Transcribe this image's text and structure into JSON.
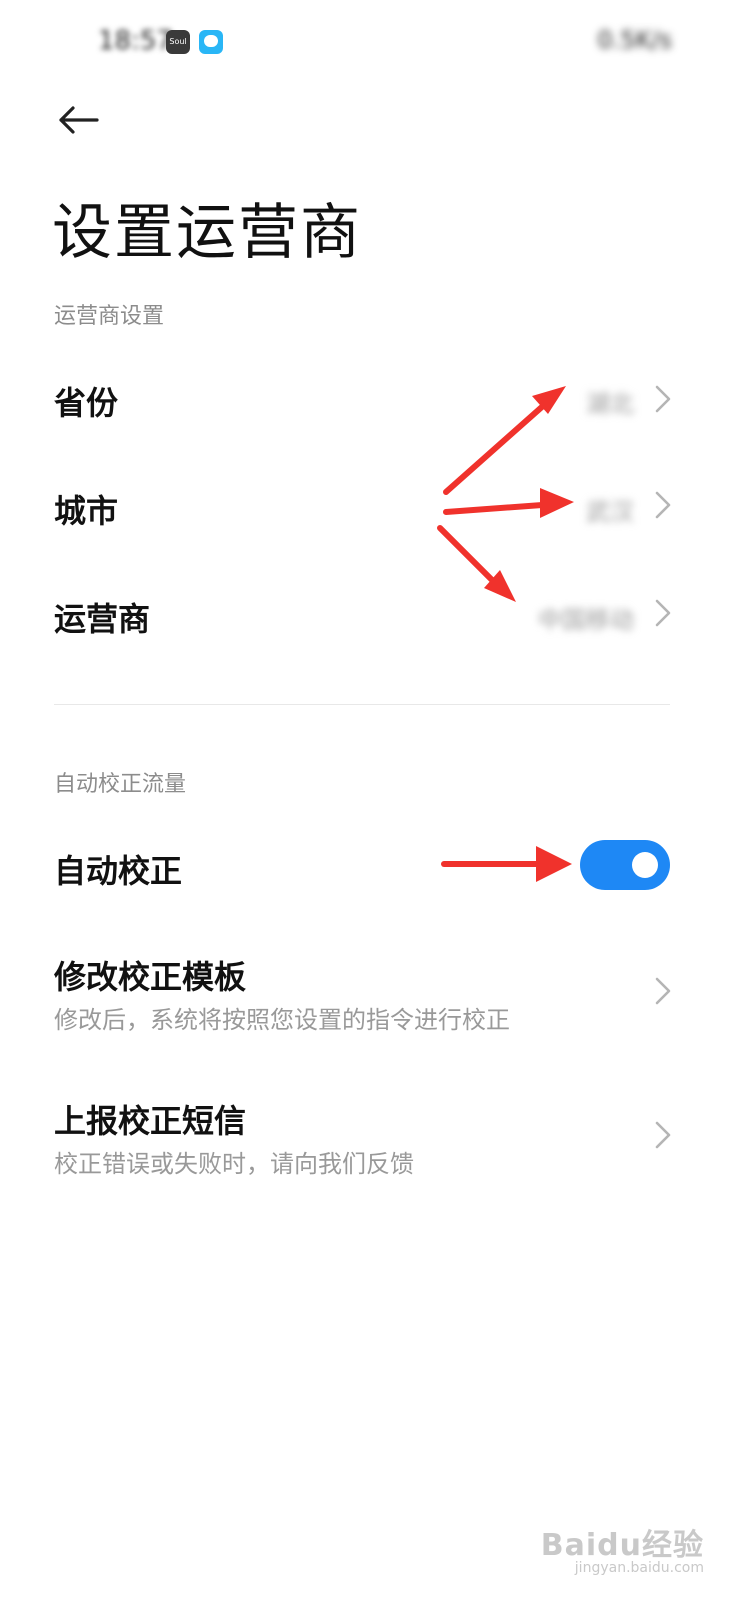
{
  "status_bar": {
    "time": "18:57",
    "app_icon_label": "Soul",
    "right_text": "0.5K/s"
  },
  "page": {
    "title": "设置运营商"
  },
  "sections": {
    "carrier_settings": {
      "header": "运营商设置",
      "rows": [
        {
          "label": "省份",
          "value": "湖北"
        },
        {
          "label": "城市",
          "value": "武汉"
        },
        {
          "label": "运营商",
          "value": "中国移动"
        }
      ]
    },
    "auto_correct": {
      "header": "自动校正流量",
      "toggle_row": {
        "label": "自动校正",
        "enabled": true
      },
      "rows": [
        {
          "label": "修改校正模板",
          "sub": "修改后，系统将按照您设置的指令进行校正"
        },
        {
          "label": "上报校正短信",
          "sub": "校正错误或失败时，请向我们反馈"
        }
      ]
    }
  },
  "watermark": {
    "brand": "Baidu经验",
    "url": "jingyan.baidu.com"
  },
  "colors": {
    "accent": "#1e88f5",
    "annotation_arrow": "#f0322c"
  }
}
